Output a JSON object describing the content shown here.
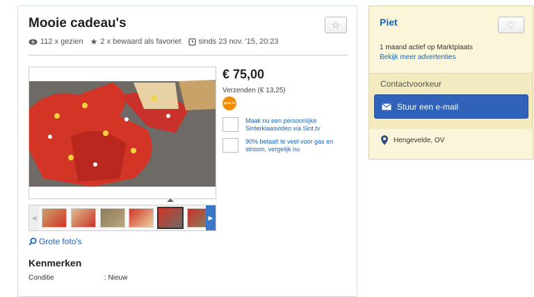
{
  "listing": {
    "title": "Mooie cadeau's",
    "views": "112 x gezien",
    "favorites": "2 x bewaard als favoriet",
    "since": "sinds 23 nov. '15, 20:23",
    "price": "€ 75,00",
    "shipping": "Verzenden (€ 13,25)",
    "shipping_carrier": "post.nl",
    "enlarge_link": "Grote foto's",
    "thumbnail_count": 6,
    "active_thumbnail": 5
  },
  "ads": [
    {
      "text": "Maak nu een persoonlijke Sinterklaasvideo via Sint.tv"
    },
    {
      "text": "90% betaalt te veel voor gas en stroom, vergelijk nu"
    }
  ],
  "kenmerken": {
    "title": "Kenmerken",
    "rows": [
      {
        "label": "Conditie",
        "value": ": Nieuw"
      }
    ]
  },
  "seller": {
    "name": "Piet",
    "active": "1 maand actief op Marktplaats",
    "more_ads_link": "Bekijk meer advertenties",
    "contact_label": "Contactvoorkeur",
    "email_button": "Stuur een e-mail",
    "location": "Hengevelde, OV"
  },
  "icons": {
    "views": "eye-icon",
    "favorites": "star-icon",
    "since": "clock-icon",
    "favorite_button": "star-outline-icon",
    "heart_button": "heart-outline-icon",
    "email": "envelope-icon",
    "location": "map-pin-icon",
    "zoom": "magnifier-icon"
  },
  "colors": {
    "link": "#1a63b8",
    "primary_button": "#2f62b8",
    "seller_panel_bg": "#fbf6d9",
    "postnl_orange": "#f28b00"
  }
}
